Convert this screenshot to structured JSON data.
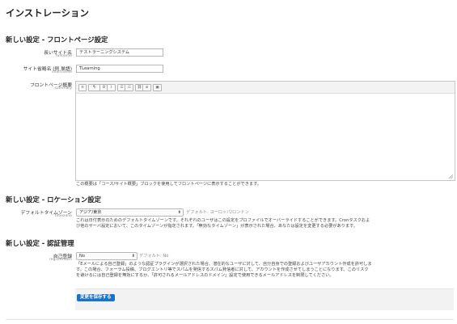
{
  "page": {
    "title": "インストレーション"
  },
  "front": {
    "heading": "新しい設定 - フロントページ設定",
    "fullname": {
      "label": "長いサイト名",
      "name": "fullname",
      "value": "テストラーニングシステム"
    },
    "shortname": {
      "label": "サイト省略名 (例 単語)",
      "name": "shortname",
      "value": "TLearning"
    },
    "summary": {
      "label": "フロントページ概要",
      "name": "summary",
      "toolbar": [
        "≡",
        "¶·",
        "B",
        "I",
        "☰",
        "☷",
        "⛓",
        "⊘",
        "▣"
      ],
      "help": "この概要は「コース/サイト概要」ブロックを使用してフロントページに表示することができます。"
    }
  },
  "location": {
    "heading": "新しい設定 - ロケーション設定",
    "timezone": {
      "label": "デフォルトタイムゾーン",
      "name": "timezone",
      "value": "アジア/東京",
      "default": "デフォルト: ヨーロッパ/ロンドン",
      "desc1": "これは日付表示のためのデフォルトタイムゾーンです。それぞれのユーザはこの設定をプロファイルでオーバーライドすることができます。Cronタスクおよ",
      "desc2": "び他のサーバ設定において、このタイムゾーンが指定されます。「無効なタイムゾーン」が表示された場合、あなたは設定を変更する必要があります。"
    }
  },
  "auth": {
    "heading": "新しい設定 - 認証管理",
    "registerauth": {
      "label": "自己登録",
      "name": "registerauth",
      "value": "No",
      "default": "デフォルト: No",
      "desc1": "「Eメールによる自己登録」のような認証プラグインが選択された場合、潜在的なユーザに対して、自分自身での登録およびユーザアカウント作成を許可しま",
      "desc2": "す。この場合、フォーラム投稿、ブログエントリ等でスパムを発信するスパム発信者に対して、アカウントを作成させてしまうことになります。このリスク",
      "desc3": "を避けるには自己登録を無効にするか、「許可されるメールアドレスのドメイン」設定で使用できるメールアドレスを制限してください。"
    }
  },
  "actions": {
    "save_label": "変更を保存する"
  },
  "colors": {
    "accent": "#1a73c6",
    "savebar": "#f2f2f2"
  }
}
